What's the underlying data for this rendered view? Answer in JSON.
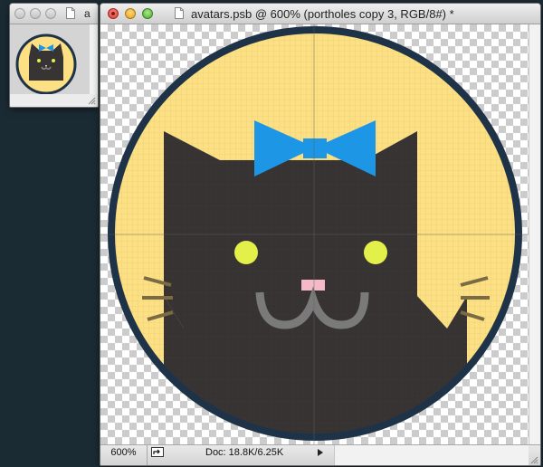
{
  "navigator": {
    "title_partial": "a"
  },
  "document": {
    "title": "avatars.psb @ 600% (portholes copy 3, RGB/8#) *",
    "status": {
      "zoom": "600%",
      "doc_info": "Doc: 18.8K/6.25K"
    }
  },
  "colors": {
    "background": "#1b2b34",
    "circle_fill": "#fde083",
    "circle_ring": "#1f3348",
    "cat_fur": "#383434",
    "bow": "#1e96e6",
    "eyes": "#e4f04a",
    "nose": "#f6b9c7",
    "mouth": "#7b7a7a",
    "whiskers": "#7b6b44"
  },
  "icons": {
    "document": "document-icon",
    "share": "share-icon",
    "status_menu": "triangle-right-icon",
    "resize": "resize-grip-icon"
  }
}
